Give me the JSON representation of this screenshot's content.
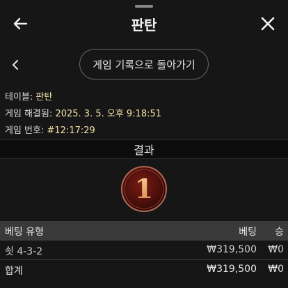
{
  "header": {
    "title": "판탄",
    "back_icon": "arrow-left-icon",
    "close_icon": "close-icon"
  },
  "history": {
    "chevron_icon": "chevron-left-icon",
    "button_label": "게임 기록으로 돌아가기"
  },
  "info": {
    "table_label": "테이블:",
    "table_value": "판탄",
    "resolved_label": "게임 해결됨:",
    "resolved_value": "2025. 3. 5. 오후 9:18:51",
    "game_no_label": "게임 번호:",
    "game_no_value": "#12:17:29"
  },
  "result": {
    "heading": "결과",
    "value": "1",
    "ball_color": "#5a1410",
    "ring_color": "#b06a55",
    "number_color": "#f2b37a"
  },
  "bets": {
    "headers": {
      "type": "베팅 유형",
      "bet": "베팅",
      "win": "승"
    },
    "rows": [
      {
        "type": "쇳 4-3-2",
        "bet": "₩319,500",
        "win": "₩0"
      }
    ],
    "total": {
      "type": "합계",
      "bet": "₩319,500",
      "win": "₩0"
    }
  },
  "colors": {
    "background": "#161616",
    "info_value": "#f0e0a8",
    "header_row": "#3a3a3a"
  }
}
